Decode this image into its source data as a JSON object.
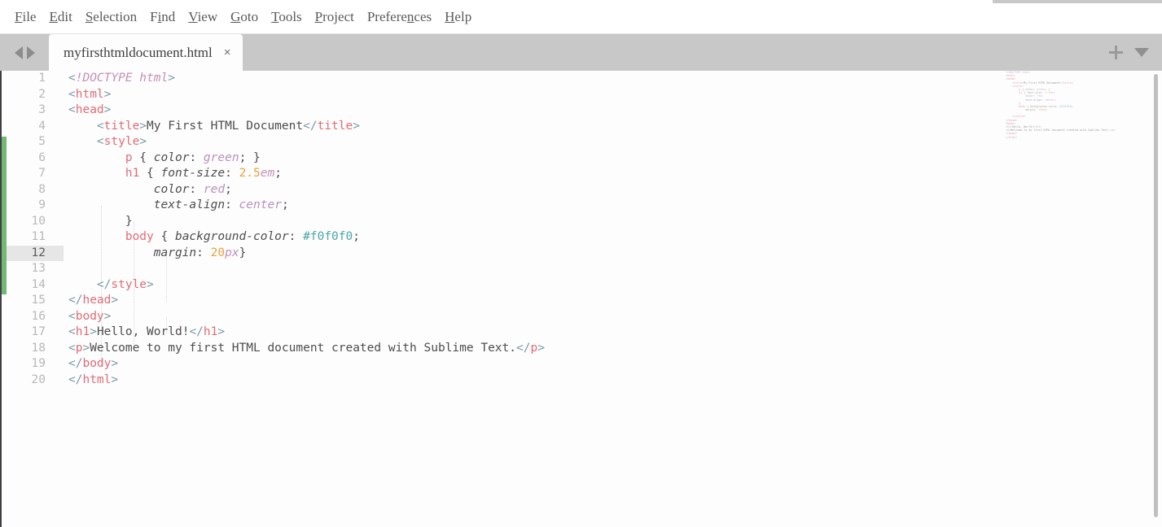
{
  "app": {
    "name": "Sublime Text"
  },
  "menubar": {
    "items": [
      {
        "label": "File",
        "mnemonic": "F"
      },
      {
        "label": "Edit",
        "mnemonic": "E"
      },
      {
        "label": "Selection",
        "mnemonic": "S"
      },
      {
        "label": "Find",
        "mnemonic": "i"
      },
      {
        "label": "View",
        "mnemonic": "V"
      },
      {
        "label": "Goto",
        "mnemonic": "G"
      },
      {
        "label": "Tools",
        "mnemonic": "T"
      },
      {
        "label": "Project",
        "mnemonic": "P"
      },
      {
        "label": "Preferences",
        "mnemonic": "n"
      },
      {
        "label": "Help",
        "mnemonic": "H"
      }
    ]
  },
  "tabbar": {
    "nav_prev_icon": "triangle-left-icon",
    "nav_next_icon": "triangle-right-icon",
    "tabs": [
      {
        "label": "myfirsthtmldocument.html",
        "active": true,
        "close_label": "×"
      }
    ],
    "new_tab_icon": "plus-icon",
    "tab_menu_icon": "chevron-down-icon"
  },
  "editor": {
    "active_line": 12,
    "total_lines": 20,
    "git_modified_marker_color": "#73b873",
    "lines": [
      {
        "n": 1,
        "tokens": [
          {
            "t": "punct",
            "v": "<"
          },
          {
            "t": "doctype",
            "v": "!DOCTYPE html"
          },
          {
            "t": "punct",
            "v": ">"
          }
        ]
      },
      {
        "n": 2,
        "tokens": [
          {
            "t": "punct",
            "v": "<"
          },
          {
            "t": "tag",
            "v": "html"
          },
          {
            "t": "punct",
            "v": ">"
          }
        ]
      },
      {
        "n": 3,
        "tokens": [
          {
            "t": "punct",
            "v": "<"
          },
          {
            "t": "tag",
            "v": "head"
          },
          {
            "t": "punct",
            "v": ">"
          }
        ]
      },
      {
        "n": 4,
        "tokens": [
          {
            "t": "text",
            "v": "    "
          },
          {
            "t": "punct",
            "v": "<"
          },
          {
            "t": "tag",
            "v": "title"
          },
          {
            "t": "punct",
            "v": ">"
          },
          {
            "t": "text",
            "v": "My First HTML Document"
          },
          {
            "t": "punct",
            "v": "</"
          },
          {
            "t": "tag",
            "v": "title"
          },
          {
            "t": "punct",
            "v": ">"
          }
        ]
      },
      {
        "n": 5,
        "tokens": [
          {
            "t": "text",
            "v": "    "
          },
          {
            "t": "punct",
            "v": "<"
          },
          {
            "t": "tag",
            "v": "style"
          },
          {
            "t": "punct",
            "v": ">"
          }
        ]
      },
      {
        "n": 6,
        "tokens": [
          {
            "t": "text",
            "v": "        "
          },
          {
            "t": "sel",
            "v": "p"
          },
          {
            "t": "brace",
            "v": " { "
          },
          {
            "t": "prop",
            "v": "color"
          },
          {
            "t": "brace",
            "v": ": "
          },
          {
            "t": "val",
            "v": "green"
          },
          {
            "t": "brace",
            "v": "; }"
          }
        ]
      },
      {
        "n": 7,
        "tokens": [
          {
            "t": "text",
            "v": "        "
          },
          {
            "t": "sel",
            "v": "h1"
          },
          {
            "t": "brace",
            "v": " { "
          },
          {
            "t": "prop",
            "v": "font-size"
          },
          {
            "t": "brace",
            "v": ": "
          },
          {
            "t": "num",
            "v": "2.5"
          },
          {
            "t": "unit",
            "v": "em"
          },
          {
            "t": "brace",
            "v": ";"
          }
        ]
      },
      {
        "n": 8,
        "tokens": [
          {
            "t": "text",
            "v": "            "
          },
          {
            "t": "prop",
            "v": "color"
          },
          {
            "t": "brace",
            "v": ": "
          },
          {
            "t": "val",
            "v": "red"
          },
          {
            "t": "brace",
            "v": ";"
          }
        ]
      },
      {
        "n": 9,
        "tokens": [
          {
            "t": "text",
            "v": "            "
          },
          {
            "t": "prop",
            "v": "text-align"
          },
          {
            "t": "brace",
            "v": ": "
          },
          {
            "t": "val",
            "v": "center"
          },
          {
            "t": "brace",
            "v": ";"
          }
        ]
      },
      {
        "n": 10,
        "tokens": [
          {
            "t": "text",
            "v": "        "
          },
          {
            "t": "brace",
            "v": "}"
          }
        ]
      },
      {
        "n": 11,
        "tokens": [
          {
            "t": "text",
            "v": "        "
          },
          {
            "t": "sel",
            "v": "body"
          },
          {
            "t": "brace",
            "v": " { "
          },
          {
            "t": "prop",
            "v": "background-color"
          },
          {
            "t": "brace",
            "v": ": "
          },
          {
            "t": "hex",
            "v": "#f0f0f0"
          },
          {
            "t": "brace",
            "v": ";"
          }
        ]
      },
      {
        "n": 12,
        "tokens": [
          {
            "t": "text",
            "v": "            "
          },
          {
            "t": "prop",
            "v": "margin"
          },
          {
            "t": "brace",
            "v": ": "
          },
          {
            "t": "num",
            "v": "20"
          },
          {
            "t": "unit",
            "v": "px"
          },
          {
            "t": "brace",
            "v": "}"
          }
        ]
      },
      {
        "n": 13,
        "tokens": []
      },
      {
        "n": 14,
        "tokens": [
          {
            "t": "text",
            "v": "    "
          },
          {
            "t": "punct",
            "v": "</"
          },
          {
            "t": "tag",
            "v": "style"
          },
          {
            "t": "punct",
            "v": ">"
          }
        ]
      },
      {
        "n": 15,
        "tokens": [
          {
            "t": "punct",
            "v": "</"
          },
          {
            "t": "tag",
            "v": "head"
          },
          {
            "t": "punct",
            "v": ">"
          }
        ]
      },
      {
        "n": 16,
        "tokens": [
          {
            "t": "punct",
            "v": "<"
          },
          {
            "t": "tag",
            "v": "body"
          },
          {
            "t": "punct",
            "v": ">"
          }
        ]
      },
      {
        "n": 17,
        "tokens": [
          {
            "t": "punct",
            "v": "<"
          },
          {
            "t": "tag",
            "v": "h1"
          },
          {
            "t": "punct",
            "v": ">"
          },
          {
            "t": "text",
            "v": "Hello, World!"
          },
          {
            "t": "punct",
            "v": "</"
          },
          {
            "t": "tag",
            "v": "h1"
          },
          {
            "t": "punct",
            "v": ">"
          }
        ]
      },
      {
        "n": 18,
        "tokens": [
          {
            "t": "punct",
            "v": "<"
          },
          {
            "t": "tag",
            "v": "p"
          },
          {
            "t": "punct",
            "v": ">"
          },
          {
            "t": "text",
            "v": "Welcome to my first HTML document created with Sublime Text."
          },
          {
            "t": "punct",
            "v": "</"
          },
          {
            "t": "tag",
            "v": "p"
          },
          {
            "t": "punct",
            "v": ">"
          }
        ]
      },
      {
        "n": 19,
        "tokens": [
          {
            "t": "punct",
            "v": "</"
          },
          {
            "t": "tag",
            "v": "body"
          },
          {
            "t": "punct",
            "v": ">"
          }
        ]
      },
      {
        "n": 20,
        "tokens": [
          {
            "t": "punct",
            "v": "</"
          },
          {
            "t": "tag",
            "v": "html"
          },
          {
            "t": "punct",
            "v": ">"
          }
        ]
      }
    ]
  },
  "minimap": {
    "visible": true
  },
  "scrollbar": {
    "vertical_visible": true
  },
  "colors": {
    "menubar_bg": "#ffffff",
    "tabbar_bg": "#c8c8c8",
    "tab_active_bg": "#fdfdfd",
    "editor_bg": "#fdfdfd",
    "active_line_gutter": "#e6e6e6",
    "lineno": "#b8b8b8",
    "tag": "#e06c75",
    "punct": "#7a9aa8",
    "value": "#b88fc0",
    "number": "#e8a33d",
    "hex": "#4aa6a6",
    "text": "#4d4d4d"
  }
}
